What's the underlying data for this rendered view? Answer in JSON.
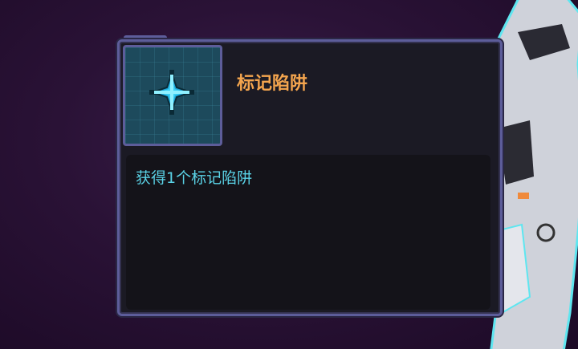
{
  "item": {
    "title": "标记陷阱",
    "description": "获得1个标记陷阱",
    "icon": "crosshair-trap-icon"
  },
  "colors": {
    "title": "#f4a54e",
    "description": "#5ad2e6",
    "frame_border": "#5d5d9a",
    "card_bg": "#1b1a24",
    "icon_bg": "#1d4a5c"
  }
}
